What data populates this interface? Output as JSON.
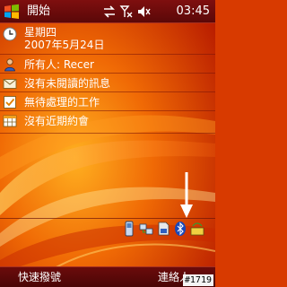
{
  "title_bar": {
    "start_label": "開始",
    "start_icon": "windows-flag-icon",
    "status_icons": [
      "sync-arrows-icon",
      "no-signal-icon",
      "volume-muted-icon"
    ],
    "clock": "03:45"
  },
  "today": {
    "date": {
      "weekday": "星期四",
      "full_date": "2007年5月24日",
      "icon": "clock-icon"
    },
    "owner": {
      "label": "所有人: Recer",
      "icon": "owner-person-icon"
    },
    "messages": {
      "label": "沒有未閱讀的訊息",
      "icon": "envelope-icon"
    },
    "tasks": {
      "label": "無待處理的工作",
      "icon": "checklist-icon"
    },
    "calendar": {
      "label": "沒有近期約會",
      "icon": "calendar-grid-icon"
    }
  },
  "tray": {
    "icons": [
      "phone-icon",
      "network-icon",
      "memory-card-icon",
      "bluetooth-icon",
      "wifi-icon"
    ]
  },
  "softkeys": {
    "left": "快速撥號",
    "right": "連絡人"
  },
  "image_tag": "#1719",
  "colors": {
    "title_bar": "#7f0f0f",
    "wallpaper_base": "#d83a00",
    "wallpaper_highlight": "#ff9a20",
    "text": "#ffffff"
  }
}
